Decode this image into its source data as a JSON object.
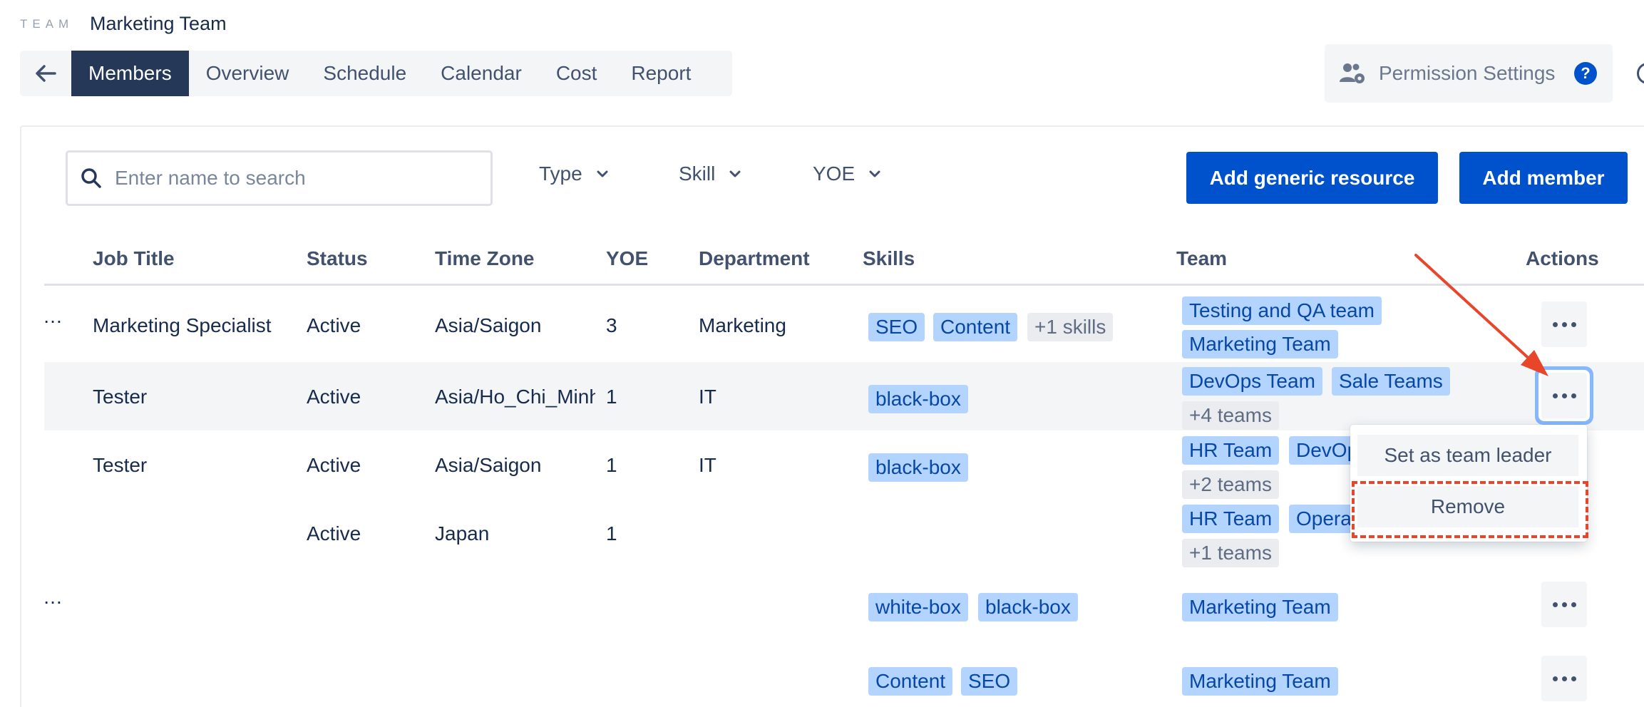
{
  "header": {
    "eyebrow": "TEAM",
    "team_name": "Marketing Team",
    "tabs": [
      "Members",
      "Overview",
      "Schedule",
      "Calendar",
      "Cost",
      "Report"
    ],
    "active_tab": "Members",
    "permission_settings_label": "Permission Settings",
    "help_label": "?"
  },
  "toolbar": {
    "search_placeholder": "Enter name to search",
    "filters": [
      "Type",
      "Skill",
      "YOE"
    ],
    "add_generic_resource_label": "Add generic resource",
    "add_member_label": "Add member"
  },
  "table": {
    "columns": [
      "Job Title",
      "Status",
      "Time Zone",
      "YOE",
      "Department",
      "Skills",
      "Team",
      "Actions"
    ],
    "rows": [
      {
        "lead": "…",
        "job_title": "Marketing Specialist",
        "status": "Active",
        "time_zone": "Asia/Saigon",
        "yoe": "3",
        "department": "Marketing",
        "skills": [
          "SEO",
          "Content"
        ],
        "skills_more": "+1 skills",
        "teams": [
          "Testing and QA team",
          "Marketing Team"
        ],
        "teams_more": ""
      },
      {
        "lead": "",
        "job_title": "Tester",
        "status": "Active",
        "time_zone": "Asia/Ho_Chi_Minh",
        "yoe": "1",
        "department": "IT",
        "skills": [
          "black-box"
        ],
        "skills_more": "",
        "teams": [
          "DevOps Team",
          "Sale Teams"
        ],
        "teams_more": "+4 teams"
      },
      {
        "lead": "",
        "job_title": "Tester",
        "status": "Active",
        "time_zone": "Asia/Saigon",
        "yoe": "1",
        "department": "IT",
        "skills": [
          "black-box"
        ],
        "skills_more": "",
        "teams": [
          "HR Team",
          "DevOps Team"
        ],
        "teams_more": "+2 teams"
      },
      {
        "lead": "",
        "job_title": "",
        "status": "Active",
        "time_zone": "Japan",
        "yoe": "1",
        "department": "",
        "skills": [],
        "skills_more": "",
        "teams": [
          "HR Team",
          "Operations"
        ],
        "teams_more": "+1 teams"
      },
      {
        "lead": "…",
        "job_title": "",
        "status": "",
        "time_zone": "",
        "yoe": "",
        "department": "",
        "skills": [
          "white-box",
          "black-box"
        ],
        "skills_more": "",
        "teams": [
          "Marketing Team"
        ],
        "teams_more": ""
      },
      {
        "lead": "",
        "job_title": "",
        "status": "",
        "time_zone": "",
        "yoe": "",
        "department": "",
        "skills": [
          "Content",
          "SEO"
        ],
        "skills_more": "",
        "teams": [
          "Marketing Team"
        ],
        "teams_more": ""
      }
    ]
  },
  "action_menu": {
    "items": [
      "Set as team leader",
      "Remove"
    ]
  },
  "colors": {
    "primary": "#0052cc",
    "nav_active": "#253858",
    "tag_bg": "#b3d4ff",
    "tag_text": "#0747a6",
    "annotation": "#e8462a",
    "focus_ring": "#85b8ff"
  }
}
